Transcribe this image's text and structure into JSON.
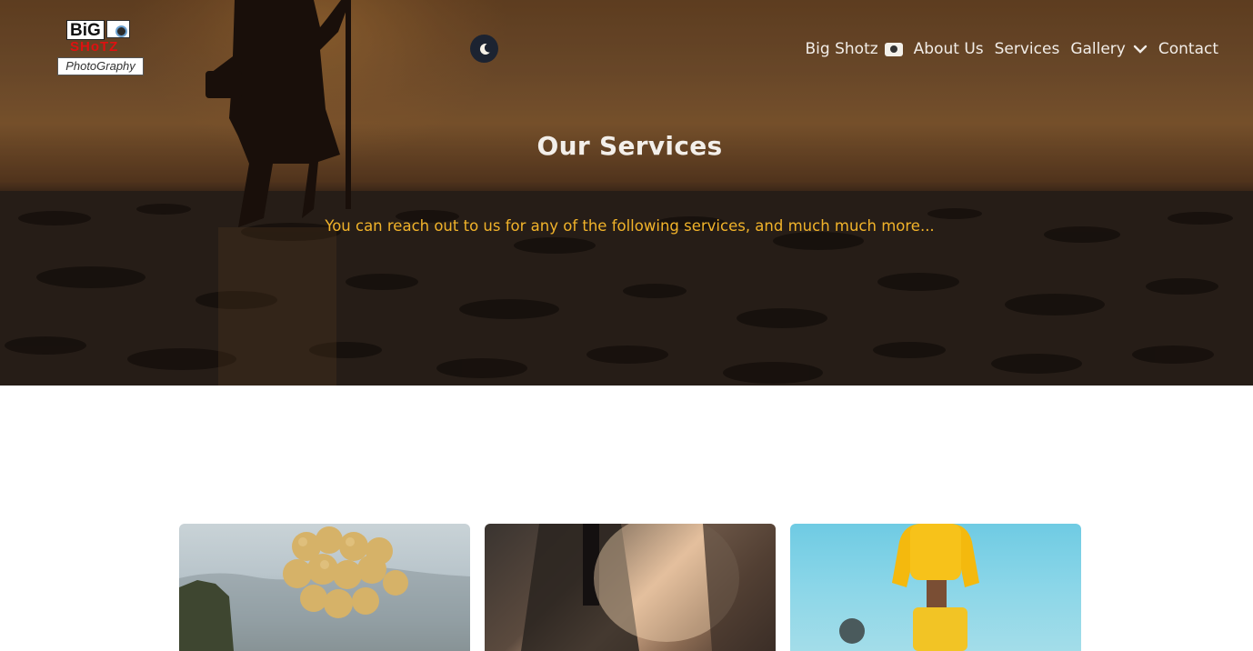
{
  "brand": {
    "logo_line1": "BiG",
    "logo_line2": "SHoTZ",
    "logo_line3": "PhotoGraphy"
  },
  "theme_toggle": {
    "icon": "moon-icon"
  },
  "nav": {
    "items": [
      {
        "label": "Big Shotz",
        "icon": "camera-icon"
      },
      {
        "label": "About Us"
      },
      {
        "label": "Services"
      },
      {
        "label": "Gallery",
        "icon": "chevron-down-icon"
      },
      {
        "label": "Contact"
      }
    ]
  },
  "hero": {
    "title": "Our Services",
    "subtitle": "You can reach out to us for any of the following services, and much much more..."
  },
  "cards": [
    {
      "image": "balloons-photo"
    },
    {
      "image": "wedding-couple-photo"
    },
    {
      "image": "fashion-model-photo"
    }
  ],
  "colors": {
    "accent": "#f1b32a",
    "toggle_bg": "#1c2331",
    "logo_red": "#e01010"
  }
}
